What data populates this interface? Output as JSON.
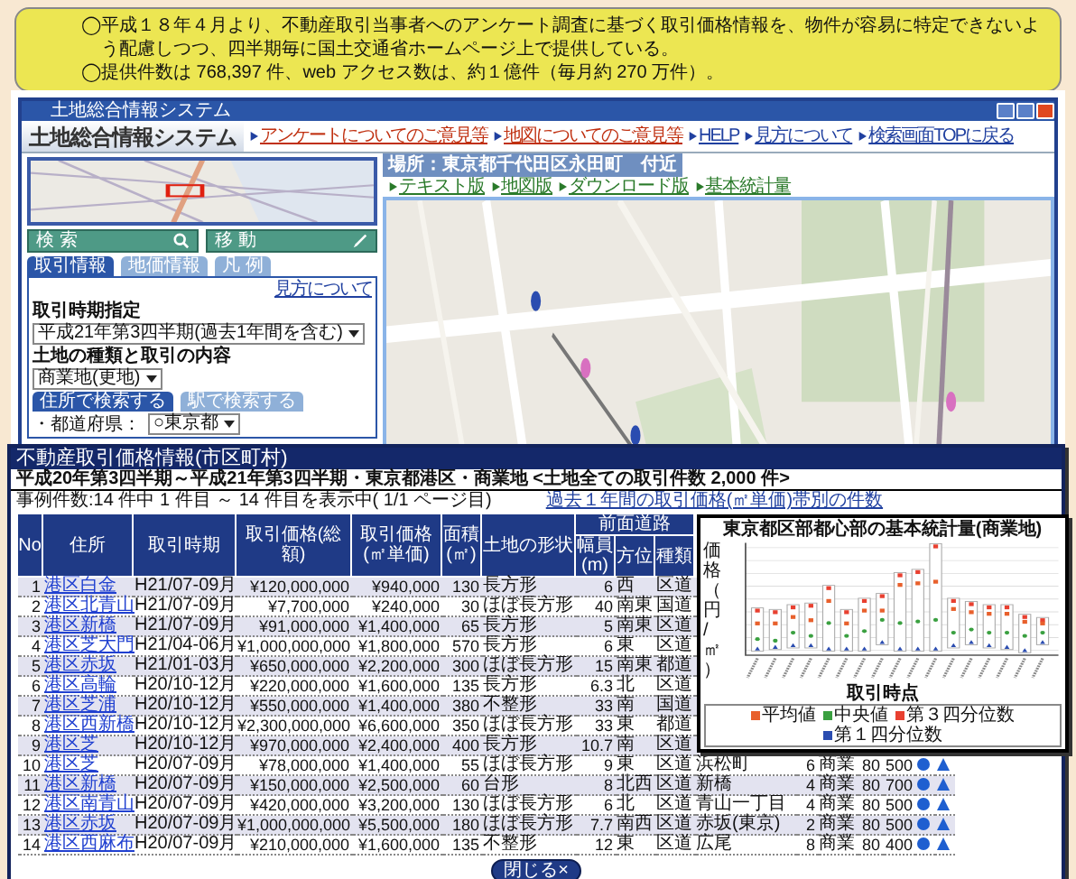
{
  "note": {
    "items": [
      "平成１８年４月より、不動産取引当事者へのアンケート調査に基づく取引価格情報を、物件が容易に特定できないよう配慮しつつ、四半期毎に国土交通省ホームページ上で提供している。",
      "提供件数は 768,397 件、web アクセス数は、約１億件（毎月約 270 万件）。"
    ],
    "bullet": "◯"
  },
  "window": {
    "title": "土地総合情報システム",
    "logo": "土地総合情報システム",
    "header_links": [
      "アンケートについてのご意見等",
      "地図についてのご意見等",
      "HELP",
      "見方について",
      "検索画面TOPに戻る"
    ],
    "location": "場所：東京都千代田区永田町　付近",
    "view_links": [
      "テキスト版",
      "地図版",
      "ダウンロード版",
      "基本統計量"
    ]
  },
  "sidebar": {
    "buttons": [
      "検 索",
      "移 動"
    ],
    "tabs": [
      {
        "label": "取引情報",
        "selected": true
      },
      {
        "label": "地価情報",
        "selected": false
      },
      {
        "label": "凡 例",
        "selected": false
      }
    ],
    "help_link": "見方について",
    "period_label": "取引時期指定",
    "period_value": "平成21年第3四半期(過去1年間を含む)",
    "type_label": "土地の種類と取引の内容",
    "type_value": "商業地(更地)",
    "search_tabs": [
      {
        "label": "住所で検索する",
        "selected": true
      },
      {
        "label": "駅で検索する",
        "selected": false
      }
    ],
    "prefecture_label": "・都道府県：",
    "prefecture_value": "○東京都"
  },
  "table_window": {
    "title": "不動産取引価格情報(市区町村)",
    "subtitle": "平成20年第3四半期～平成21年第3四半期・東京都港区・商業地 <土地全ての取引件数 2,000 件>",
    "count": "事例件数:14 件中 1 件目 ～ 14 件目を表示中( 1/1 ページ目)",
    "link": "過去１年間の取引価格(㎡単価)帯別の件数",
    "road_group": "前面道路",
    "columns": [
      {
        "label": "No",
        "kind": "num"
      },
      {
        "label": "住所",
        "kind": "link"
      },
      {
        "label": "取引時期",
        "kind": "text"
      },
      {
        "label": "取引価格(総額)",
        "kind": "num"
      },
      {
        "label": "取引価格(㎡単価)",
        "kind": "num"
      },
      {
        "label": "面積(㎡)",
        "kind": "num"
      },
      {
        "label": "土地の形状",
        "kind": "text"
      },
      {
        "label": "幅員(m)",
        "kind": "num"
      },
      {
        "label": "方位",
        "kind": "text"
      },
      {
        "label": "種類",
        "kind": "text"
      }
    ],
    "rows": [
      {
        "cells": [
          "1",
          "港区白金",
          "H21/07-09月",
          "¥120,000,000",
          "¥940,000",
          "130",
          "長方形",
          "6",
          "西",
          "区道"
        ]
      },
      {
        "cells": [
          "2",
          "港区北青山",
          "H21/07-09月",
          "¥7,700,000",
          "¥240,000",
          "30",
          "ほぼ長方形",
          "40",
          "南東",
          "国道"
        ]
      },
      {
        "cells": [
          "3",
          "港区新橋",
          "H21/07-09月",
          "¥91,000,000",
          "¥1,400,000",
          "65",
          "長方形",
          "5",
          "南東",
          "区道"
        ]
      },
      {
        "cells": [
          "4",
          "港区芝大門",
          "H21/04-06月",
          "¥1,000,000,000",
          "¥1,800,000",
          "570",
          "長方形",
          "6",
          "東",
          "区道"
        ]
      },
      {
        "cells": [
          "5",
          "港区赤坂",
          "H21/01-03月",
          "¥650,000,000",
          "¥2,200,000",
          "300",
          "ほぼ長方形",
          "15",
          "南東",
          "都道"
        ]
      },
      {
        "cells": [
          "6",
          "港区高輪",
          "H20/10-12月",
          "¥220,000,000",
          "¥1,600,000",
          "135",
          "長方形",
          "6.3",
          "北",
          "区道"
        ]
      },
      {
        "cells": [
          "7",
          "港区芝浦",
          "H20/10-12月",
          "¥550,000,000",
          "¥1,400,000",
          "380",
          "不整形",
          "33",
          "南",
          "国道"
        ]
      },
      {
        "cells": [
          "8",
          "港区西新橋",
          "H20/10-12月",
          "¥2,300,000,000",
          "¥6,600,000",
          "350",
          "ほぼ長方形",
          "33",
          "東",
          "都道"
        ]
      },
      {
        "cells": [
          "9",
          "港区芝",
          "H20/10-12月",
          "¥970,000,000",
          "¥2,400,000",
          "400",
          "長方形",
          "10.7",
          "南",
          "区道"
        ]
      },
      {
        "cells": [
          "10",
          "港区芝",
          "H20/07-09月",
          "¥78,000,000",
          "¥1,400,000",
          "55",
          "ほぼ長方形",
          "9",
          "東",
          "区道"
        ],
        "extra": [
          "浜松町",
          "6",
          "商業",
          "80",
          "500"
        ],
        "markers": true
      },
      {
        "cells": [
          "11",
          "港区新橋",
          "H20/07-09月",
          "¥150,000,000",
          "¥2,500,000",
          "60",
          "台形",
          "8",
          "北西",
          "区道"
        ],
        "extra": [
          "新橋",
          "4",
          "商業",
          "80",
          "700"
        ],
        "markers": true
      },
      {
        "cells": [
          "12",
          "港区南青山",
          "H20/07-09月",
          "¥420,000,000",
          "¥3,200,000",
          "130",
          "ほぼ長方形",
          "6",
          "北",
          "区道"
        ],
        "extra": [
          "青山一丁目",
          "4",
          "商業",
          "80",
          "500"
        ],
        "markers": true
      },
      {
        "cells": [
          "13",
          "港区赤坂",
          "H20/07-09月",
          "¥1,000,000,000",
          "¥5,500,000",
          "180",
          "ほぼ長方形",
          "7.7",
          "南西",
          "区道"
        ],
        "extra": [
          "赤坂(東京)",
          "2",
          "商業",
          "80",
          "500"
        ],
        "markers": true
      },
      {
        "cells": [
          "14",
          "港区西麻布",
          "H20/07-09月",
          "¥210,000,000",
          "¥1,600,000",
          "135",
          "不整形",
          "12",
          "東",
          "区道"
        ],
        "extra": [
          "広尾",
          "8",
          "商業",
          "80",
          "400"
        ],
        "markers": true
      }
    ],
    "close_button": "閉じる×"
  },
  "chart_window": {
    "title": "東京都区部都心部の基本統計量(商業地)",
    "ylabel": "価格（円/㎡）",
    "xlabel": "取引時点",
    "legend": [
      {
        "label": "平均値",
        "color": "#e8602c"
      },
      {
        "label": "中央値",
        "color": "#3aa040"
      },
      {
        "label": "第３四分位数",
        "color": "#e84030"
      },
      {
        "label": "第１四分位数",
        "color": "#2a4cb0"
      }
    ]
  }
}
